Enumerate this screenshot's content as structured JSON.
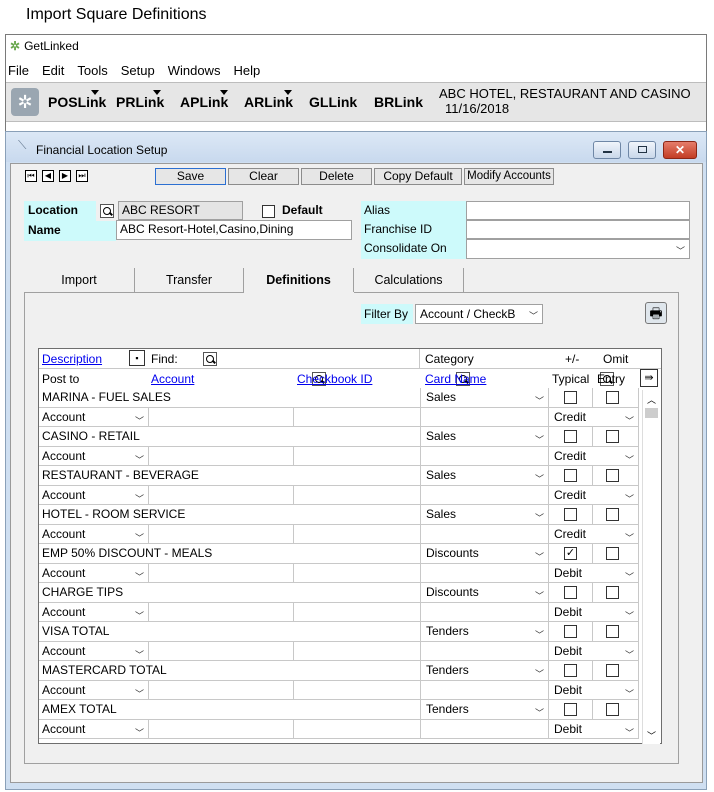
{
  "caption": "Import Square Definitions",
  "app": {
    "title": "GetLinked"
  },
  "menu": [
    "File",
    "Edit",
    "Tools",
    "Setup",
    "Windows",
    "Help"
  ],
  "toolbar": {
    "buttons": [
      "POSLink",
      "PRLink",
      "APLink",
      "ARLink",
      "GLLink",
      "BRLink"
    ],
    "company": "ABC HOTEL, RESTAURANT  AND CASINO",
    "date": "11/16/2018"
  },
  "window": {
    "title": "Financial Location Setup"
  },
  "actions": [
    "Save",
    "Clear",
    "Delete",
    "Copy Default",
    "Modify Accounts"
  ],
  "location": {
    "location_label": "Location",
    "location_value": "ABC RESORT",
    "default_label": "Default",
    "name_label": "Name",
    "name_value": "ABC Resort-Hotel,Casino,Dining",
    "alias_label": "Alias",
    "franchise_label": "Franchise ID",
    "consolidate_label": "Consolidate On"
  },
  "tabs": [
    "Import",
    "Transfer",
    "Definitions",
    "Calculations"
  ],
  "filter": {
    "label": "Filter By",
    "value": "Account / CheckB"
  },
  "grid": {
    "headers": {
      "description": "Description",
      "find": "Find:",
      "category": "Category",
      "plusminus": "+/-",
      "omit": "Omit",
      "post_to": "Post to",
      "account": "Account",
      "checkbook": "Checkbook ID",
      "card_name": "Card Name",
      "typical": "Typical",
      "entry": "Entry"
    },
    "rows": [
      {
        "description": "MARINA - FUEL SALES",
        "category": "Sales",
        "post_to": "Account",
        "typical": "Credit",
        "pm_checked": false
      },
      {
        "description": "CASINO - RETAIL",
        "category": "Sales",
        "post_to": "Account",
        "typical": "Credit",
        "pm_checked": false
      },
      {
        "description": "RESTAURANT - BEVERAGE",
        "category": "Sales",
        "post_to": "Account",
        "typical": "Credit",
        "pm_checked": false
      },
      {
        "description": "HOTEL - ROOM SERVICE",
        "category": "Sales",
        "post_to": "Account",
        "typical": "Credit",
        "pm_checked": false
      },
      {
        "description": "EMP 50% DISCOUNT - MEALS",
        "category": "Discounts",
        "post_to": "Account",
        "typical": "Debit",
        "pm_checked": true
      },
      {
        "description": "CHARGE TIPS",
        "category": "Discounts",
        "post_to": "Account",
        "typical": "Debit",
        "pm_checked": false
      },
      {
        "description": "VISA TOTAL",
        "category": "Tenders",
        "post_to": "Account",
        "typical": "Debit",
        "pm_checked": false
      },
      {
        "description": "MASTERCARD TOTAL",
        "category": "Tenders",
        "post_to": "Account",
        "typical": "Debit",
        "pm_checked": false
      },
      {
        "description": "AMEX TOTAL",
        "category": "Tenders",
        "post_to": "Account",
        "typical": "Debit",
        "pm_checked": false
      }
    ]
  }
}
